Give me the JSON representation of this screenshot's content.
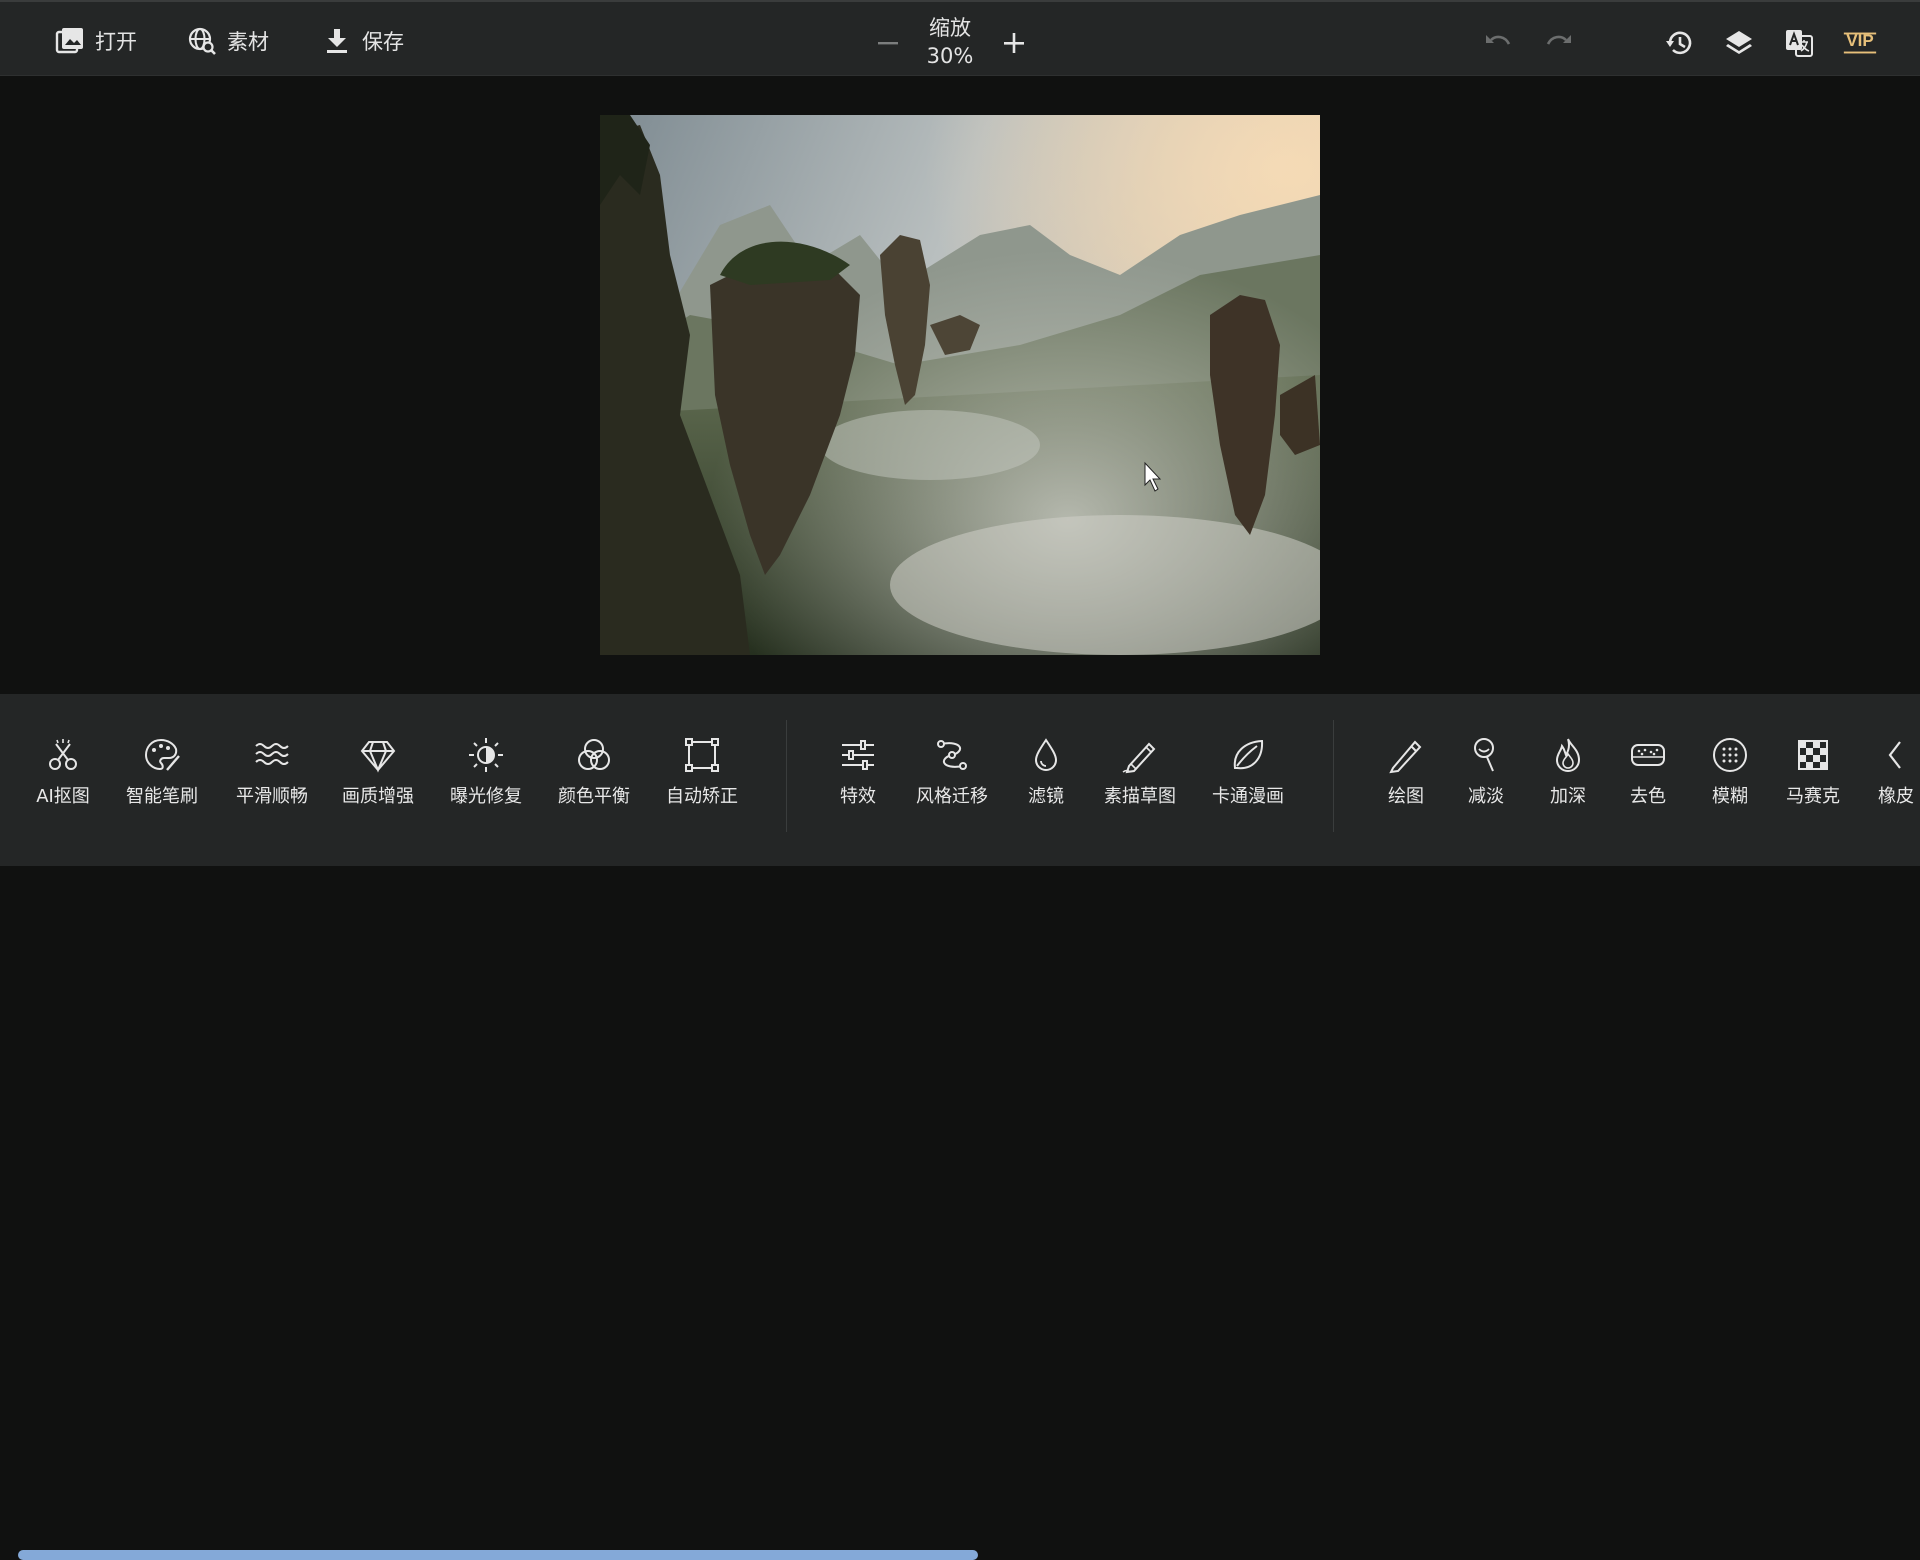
{
  "toolbar": {
    "open_label": "打开",
    "assets_label": "素材",
    "save_label": "保存",
    "zoom_label": "缩放",
    "zoom_value": "30%",
    "vip_label": "VIP"
  },
  "tools": {
    "ai_cutout": "AI抠图",
    "smart_brush": "智能笔刷",
    "smooth": "平滑顺畅",
    "enhance": "画质增强",
    "exposure_fix": "曝光修复",
    "color_balance": "颜色平衡",
    "auto_straighten": "自动矫正",
    "effects": "特效",
    "style_transfer": "风格迁移",
    "filter": "滤镜",
    "sketch": "素描草图",
    "cartoon": "卡通漫画",
    "draw": "绘图",
    "dodge": "减淡",
    "burn": "加深",
    "desaturate": "去色",
    "blur": "模糊",
    "mosaic": "马赛克",
    "eraser": "橡皮"
  },
  "colors": {
    "topbar_bg": "#242626",
    "workspace_bg": "#101110",
    "vip_gold": "#e7c07a",
    "scrollbar": "#84a9d8"
  }
}
